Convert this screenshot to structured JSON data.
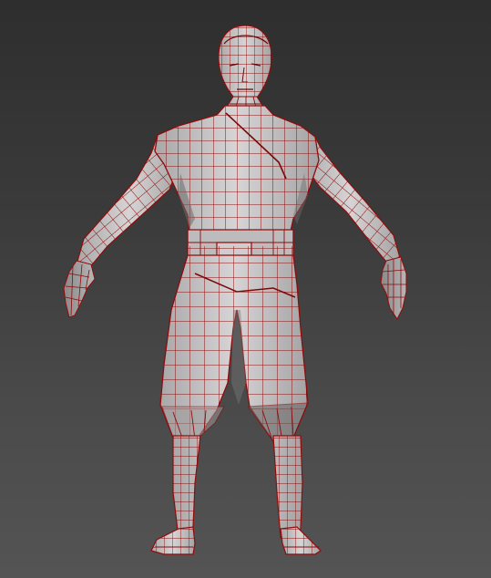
{
  "viewport": {
    "background_top": "#2e2e2e",
    "background_bottom": "#545454"
  },
  "model": {
    "surface_color": "#c8c6c6",
    "shadow_color": "#8d8b8b",
    "wire_color": "#8e0c0c",
    "display_mode": "wireframe-on-shaded"
  }
}
